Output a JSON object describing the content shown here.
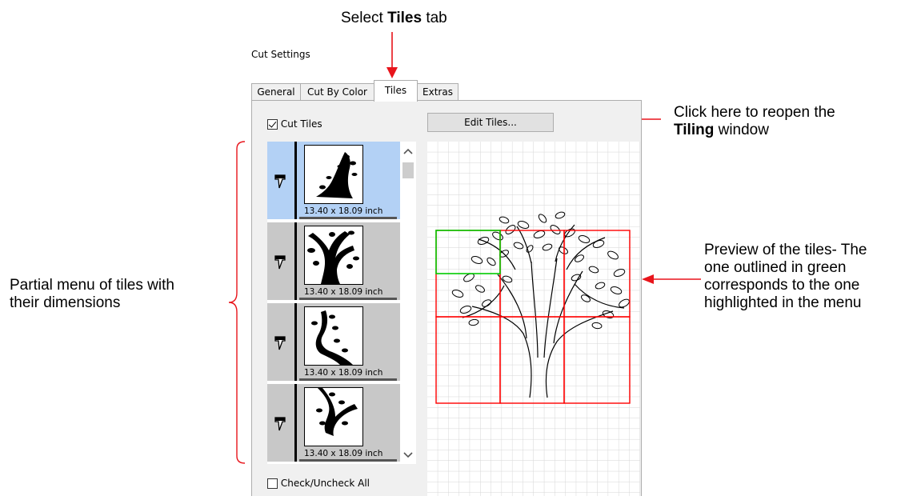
{
  "annotations": {
    "tab_callout_pre": "Select ",
    "tab_callout_bold": "Tiles",
    "tab_callout_post": " tab",
    "edit_callout_line1": "Click here to reopen the",
    "edit_callout_bold": "Tiling",
    "edit_callout_line2_post": " window",
    "menu_callout_line1": "Partial menu of tiles with",
    "menu_callout_line2": "their dimensions",
    "preview_callout": [
      "Preview of the tiles- The",
      "one outlined in green",
      "corresponds to the one",
      "highlighted in the menu"
    ]
  },
  "dialog": {
    "title": "Cut Settings",
    "tabs": [
      "General",
      "Cut By Color",
      "Tiles",
      "Extras"
    ],
    "active_tab": "Tiles",
    "cut_tiles_label": "Cut Tiles",
    "cut_tiles_checked": true,
    "edit_tiles_label": "Edit Tiles...",
    "check_all_label": "Check/Uncheck All",
    "check_all_checked": false
  },
  "tiles": [
    {
      "dimensions": "13.40 x 18.09 inch",
      "selected": true
    },
    {
      "dimensions": "13.40 x 18.09 inch",
      "selected": false
    },
    {
      "dimensions": "13.40 x 18.09 inch",
      "selected": false
    },
    {
      "dimensions": "13.40 x 18.09 inch",
      "selected": false
    }
  ],
  "colors": {
    "selected_row": "#b3d1f5",
    "unselected_row": "#c8c8c8",
    "tile_outline": "#ff0000",
    "selected_tile_outline": "#00cc00",
    "arrow": "#e8141b"
  },
  "icons": {
    "tile_marker": "blade-icon",
    "scroll_up": "chevron-up-icon",
    "scroll_down": "chevron-down-icon"
  }
}
